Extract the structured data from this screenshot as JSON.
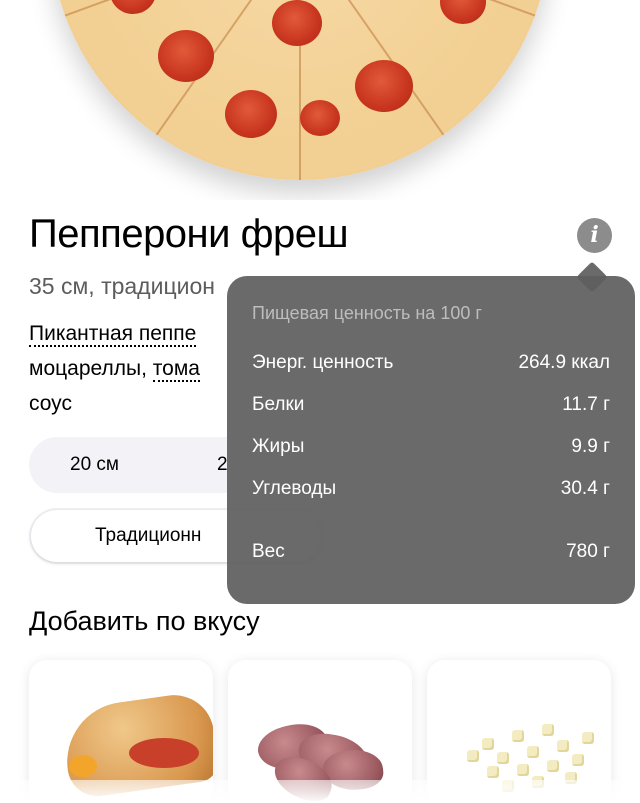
{
  "product": {
    "title": "Пепперони фреш",
    "subtitle": "35 см, традицион",
    "description": {
      "line1": "Пикантная пеппе",
      "line2a": "моцареллы, ",
      "line2b": "тома",
      "line3": "соус"
    }
  },
  "info_button": {
    "icon": "info-icon"
  },
  "size_selector": {
    "options": [
      "20 см",
      "2"
    ]
  },
  "dough_selector": {
    "selected": "Традиционн"
  },
  "add_section": {
    "title": "Добавить по вкусу",
    "cards": [
      {
        "icon": "calzone-image"
      },
      {
        "icon": "ham-image"
      },
      {
        "icon": "mozzarella-cubes-image"
      }
    ]
  },
  "nutrition": {
    "title": "Пищевая ценность на 100 г",
    "rows": [
      {
        "label": "Энерг. ценность",
        "value": "264.9 ккал"
      },
      {
        "label": "Белки",
        "value": "11.7 г"
      },
      {
        "label": "Жиры",
        "value": "9.9 г"
      },
      {
        "label": "Углеводы",
        "value": "30.4 г"
      }
    ],
    "weight": {
      "label": "Вес",
      "value": "780 г"
    }
  }
}
